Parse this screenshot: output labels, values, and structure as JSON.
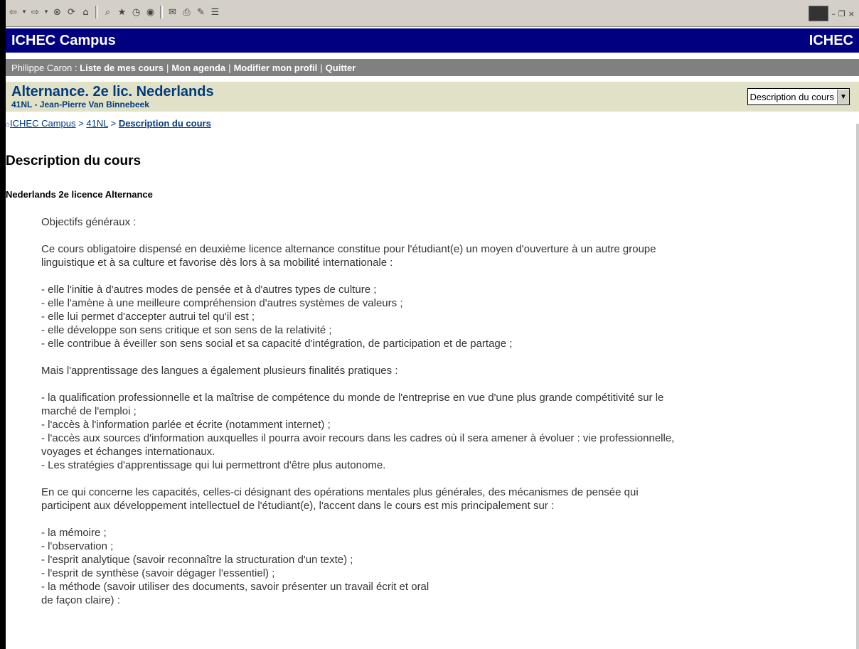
{
  "app": {
    "site_name_left": "ICHEC Campus",
    "site_name_right": "ICHEC"
  },
  "user_bar": {
    "user": "Philippe Caron",
    "colon": ":",
    "links": [
      "Liste de mes cours",
      "Mon agenda",
      "Modifier mon profil",
      "Quitter"
    ],
    "separator": "|"
  },
  "course": {
    "title": "Alternance. 2e lic. Nederlands",
    "subtitle": "41NL - Jean-Pierre Van Binnebeek",
    "selector_value": "Description du cours"
  },
  "breadcrumb": {
    "items": [
      "ICHEC Campus",
      "41NL",
      "Description du cours"
    ],
    "separator": ">"
  },
  "page": {
    "heading": "Description du cours",
    "subheading": "Nederlands 2e licence Alternance",
    "blocks": [
      {
        "lines": [
          "Objectifs généraux :"
        ]
      },
      {
        "lines": [
          "Ce cours obligatoire dispensé en deuxième licence alternance constitue pour l'étudiant(e) un moyen d'ouverture à un autre groupe",
          "linguistique et à sa culture et favorise dès lors à sa mobilité internationale :"
        ]
      },
      {
        "lines": [
          "- elle l'initie à d'autres modes de pensée et à d'autres types de culture ;",
          "- elle l'amène à une meilleure compréhension d'autres systèmes de valeurs ;",
          "- elle lui permet d'accepter autrui tel qu'il est ;",
          "- elle développe son sens critique et son sens de la relativité ;",
          "- elle contribue à éveiller son sens social et sa capacité d'intégration, de participation et de partage ;"
        ]
      },
      {
        "lines": [
          "Mais l'apprentissage des langues a également plusieurs finalités pratiques :"
        ]
      },
      {
        "lines": [
          "- la qualification professionnelle et la maîtrise de compétence du monde de l'entreprise en vue d'une plus grande compétitivité sur le",
          "marché de l'emploi ;",
          "- l'accès à l'information parlée et écrite (notamment internet) ;",
          "- l'accès aux sources d'information auxquelles il pourra avoir recours dans les cadres où il sera amener à évoluer : vie professionnelle,",
          "voyages et échanges internationaux.",
          "- Les stratégies d'apprentissage qui lui permettront d'être plus autonome."
        ]
      },
      {
        "lines": [
          "En ce qui concerne les capacités, celles-ci désignant des opérations mentales plus générales, des mécanismes de pensée qui",
          "participent aux développement intellectuel de l'étudiant(e), l'accent dans le cours est mis principalement sur :"
        ]
      },
      {
        "lines": [
          "- la mémoire ;",
          "- l'observation ;",
          "- l'esprit analytique (savoir reconnaître la structuration d'un texte) ;",
          "- l'esprit de synthèse (savoir dégager l'essentiel) ;",
          "- la méthode (savoir utiliser des documents, savoir présenter un travail écrit et oral",
          "de façon claire) :"
        ]
      }
    ]
  },
  "icons": {
    "toolbar": [
      "back-icon",
      "back-dropdown-icon",
      "forward-icon",
      "forward-dropdown-icon",
      "stop-icon",
      "refresh-icon",
      "home-icon",
      "search-icon",
      "favorites-icon",
      "history-icon",
      "media-icon",
      "mail-icon",
      "print-icon",
      "edit-icon",
      "discuss-icon"
    ]
  },
  "colors": {
    "header_bg": "#000080",
    "user_bar_bg": "#808080",
    "course_bar_bg": "#e1e1c8",
    "course_text": "#003c7d"
  }
}
